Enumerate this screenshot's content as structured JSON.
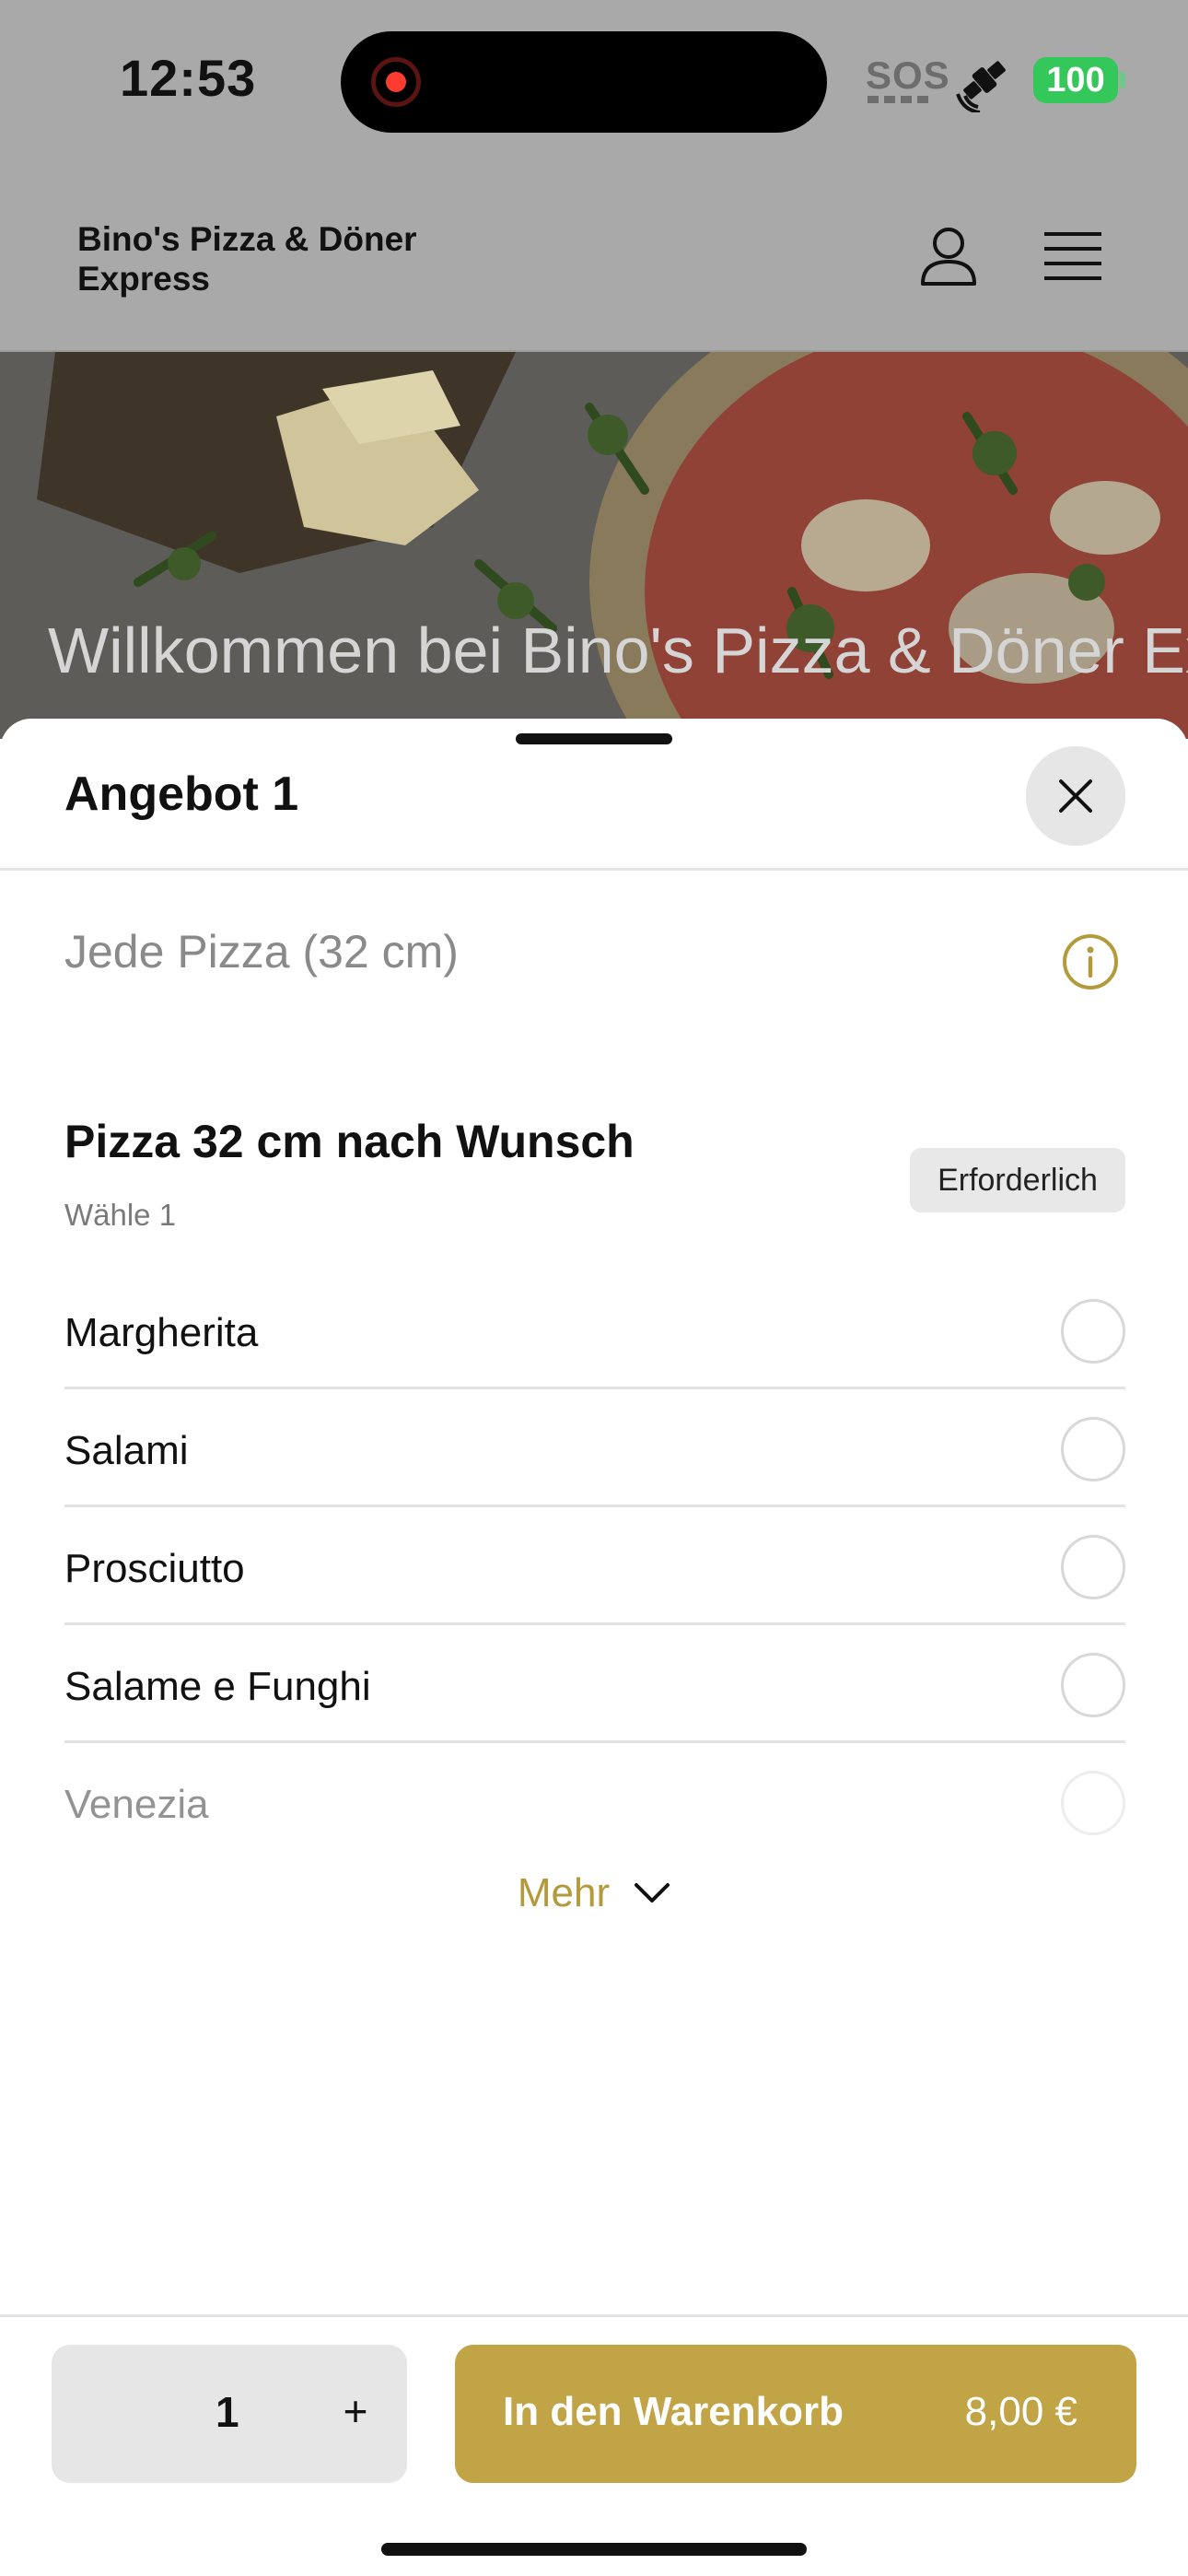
{
  "status_bar": {
    "time": "12:53",
    "sos": "SOS",
    "battery": "100"
  },
  "header": {
    "title": "Bino's Pizza & Döner Express"
  },
  "hero": {
    "welcome": "Willkommen bei Bino's Pizza & Döner Express"
  },
  "sheet": {
    "title": "Angebot 1",
    "description": "Jede Pizza (32 cm)",
    "group": {
      "title": "Pizza 32 cm nach Wunsch",
      "subtitle": "Wähle 1",
      "badge": "Erforderlich",
      "options": [
        {
          "label": "Margherita"
        },
        {
          "label": "Salami"
        },
        {
          "label": "Prosciutto"
        },
        {
          "label": "Salame e Funghi"
        },
        {
          "label": "Venezia"
        }
      ],
      "more_label": "Mehr"
    }
  },
  "footer": {
    "quantity": "1",
    "plus": "+",
    "add_to_cart": "In den Warenkorb",
    "price": "8,00 €"
  },
  "colors": {
    "accent": "#c1a446",
    "dim_overlay": "#a9a9a9",
    "battery": "#34c759",
    "record": "#ff3b30"
  },
  "icons": {
    "user": "user-icon",
    "menu": "menu-icon",
    "close": "close-icon",
    "info": "info-icon",
    "chevron": "chevron-down-icon",
    "satellite": "satellite-icon"
  }
}
